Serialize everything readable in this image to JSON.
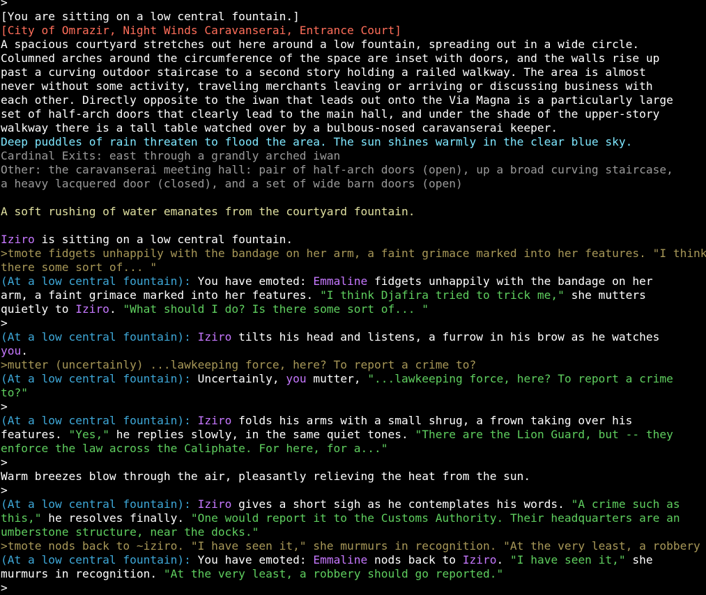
{
  "window": {
    "title": ""
  },
  "colors": {
    "background": "#000000",
    "white": "#ffffff",
    "room_title": "#ff6e5a",
    "weather": "#7fe7ff",
    "exits": "#9a9a9a",
    "ambient": "#e0e0a0",
    "name": "#c678ff",
    "echo": "#a89858",
    "location": "#3ea8d8",
    "speech": "#5fcf5f"
  },
  "terminal": {
    "lines": [
      [
        {
          "t": ">",
          "c": "white"
        }
      ],
      [
        {
          "t": "[You are sitting on a low central fountain.]",
          "c": "white"
        }
      ],
      [
        {
          "t": "[City of Omrazir, Night Winds Caravanserai, Entrance Court]",
          "c": "room_title"
        }
      ],
      [
        {
          "t": "A spacious courtyard stretches out here around a low fountain, spreading out in a wide circle.",
          "c": "white"
        }
      ],
      [
        {
          "t": "Columned arches around the circumference of the space are inset with doors, and the walls rise up",
          "c": "white"
        }
      ],
      [
        {
          "t": "past a curving outdoor staircase to a second story holding a railed walkway. The area is almost",
          "c": "white"
        }
      ],
      [
        {
          "t": "never without some activity, traveling merchants leaving or arriving or discussing business with",
          "c": "white"
        }
      ],
      [
        {
          "t": "each other. Directly opposite to the iwan that leads out onto the Via Magna is a particularly large",
          "c": "white"
        }
      ],
      [
        {
          "t": "set of half-arch doors that clearly lead to the main hall, and under the shade of the upper-story",
          "c": "white"
        }
      ],
      [
        {
          "t": "walkway there is a tall table watched over by a bulbous-nosed caravanserai keeper.",
          "c": "white"
        }
      ],
      [
        {
          "t": "Deep puddles of rain threaten to flood the area. The sun shines warmly in the clear blue sky.",
          "c": "weather"
        }
      ],
      [
        {
          "t": "Cardinal Exits: east through a grandly arched iwan",
          "c": "exits"
        }
      ],
      [
        {
          "t": "Other: the caravanserai meeting hall: pair of half-arch doors (open), up a broad curving staircase,",
          "c": "exits"
        }
      ],
      [
        {
          "t": "a heavy lacquered door (closed), and a set of wide barn doors (open)",
          "c": "exits"
        }
      ],
      [],
      [
        {
          "t": "A soft rushing of water emanates from the courtyard fountain.",
          "c": "ambient"
        }
      ],
      [],
      [
        {
          "t": "Iziro",
          "c": "name"
        },
        {
          "t": " is sitting on a low central fountain.",
          "c": "white"
        }
      ],
      [
        {
          "t": ">tmote fidgets unhappily with the bandage on her arm, a faint grimace marked into her features. \"I think Dj",
          "c": "echo"
        }
      ],
      [
        {
          "t": "there some sort of... \"",
          "c": "echo"
        }
      ],
      [
        {
          "t": "(At a low central fountain): ",
          "c": "location"
        },
        {
          "t": "You have emoted: ",
          "c": "white"
        },
        {
          "t": "Emmaline",
          "c": "name"
        },
        {
          "t": " fidgets unhappily with the bandage on her",
          "c": "white"
        }
      ],
      [
        {
          "t": "arm, a faint grimace marked into her features. ",
          "c": "white"
        },
        {
          "t": "\"I think Djafira tried to trick me,\"",
          "c": "speech"
        },
        {
          "t": " she mutters",
          "c": "white"
        }
      ],
      [
        {
          "t": "quietly to ",
          "c": "white"
        },
        {
          "t": "Iziro",
          "c": "name"
        },
        {
          "t": ". ",
          "c": "white"
        },
        {
          "t": "\"What should I do? Is there some sort of... \"",
          "c": "speech"
        }
      ],
      [
        {
          "t": ">",
          "c": "white"
        }
      ],
      [
        {
          "t": "(At a low central fountain): ",
          "c": "location"
        },
        {
          "t": "Iziro",
          "c": "name"
        },
        {
          "t": " tilts his head and listens, a furrow in his brow as he watches",
          "c": "white"
        }
      ],
      [
        {
          "t": "you",
          "c": "name"
        },
        {
          "t": ".",
          "c": "white"
        }
      ],
      [
        {
          "t": ">mutter (uncertainly) ...lawkeeping force, here? To report a crime to?",
          "c": "echo"
        }
      ],
      [
        {
          "t": "(At a low central fountain): ",
          "c": "location"
        },
        {
          "t": "Uncertainly, ",
          "c": "white"
        },
        {
          "t": "you",
          "c": "name"
        },
        {
          "t": " mutter, ",
          "c": "white"
        },
        {
          "t": "\"...lawkeeping force, here? To report a crime",
          "c": "speech"
        }
      ],
      [
        {
          "t": "to?\"",
          "c": "speech"
        }
      ],
      [
        {
          "t": ">",
          "c": "white"
        }
      ],
      [
        {
          "t": "(At a low central fountain): ",
          "c": "location"
        },
        {
          "t": "Iziro",
          "c": "name"
        },
        {
          "t": " folds his arms with a small shrug, a frown taking over his",
          "c": "white"
        }
      ],
      [
        {
          "t": "features. ",
          "c": "white"
        },
        {
          "t": "\"Yes,\"",
          "c": "speech"
        },
        {
          "t": " he replies slowly, in the same quiet tones. ",
          "c": "white"
        },
        {
          "t": "\"There are the Lion Guard, but -- they",
          "c": "speech"
        }
      ],
      [
        {
          "t": "enforce the law across the Caliphate. For here, for a...\"",
          "c": "speech"
        }
      ],
      [
        {
          "t": ">",
          "c": "white"
        }
      ],
      [
        {
          "t": "Warm breezes blow through the air, pleasantly relieving the heat from the sun.",
          "c": "white"
        }
      ],
      [
        {
          "t": ">",
          "c": "white"
        }
      ],
      [
        {
          "t": "(At a low central fountain): ",
          "c": "location"
        },
        {
          "t": "Iziro",
          "c": "name"
        },
        {
          "t": " gives a short sigh as he contemplates his words. ",
          "c": "white"
        },
        {
          "t": "\"A crime such as",
          "c": "speech"
        }
      ],
      [
        {
          "t": "this,\"",
          "c": "speech"
        },
        {
          "t": " he resolves finally. ",
          "c": "white"
        },
        {
          "t": "\"One would report it to the Customs Authority. Their headquarters are an",
          "c": "speech"
        }
      ],
      [
        {
          "t": "umberstone structure, near the docks.\"",
          "c": "speech"
        }
      ],
      [
        {
          "t": ">tmote nods back to ~iziro. \"I have seen it,\" she murmurs in recognition. \"At the very least, a robbery sh",
          "c": "echo"
        }
      ],
      [
        {
          "t": "(At a low central fountain): ",
          "c": "location"
        },
        {
          "t": "You have emoted: ",
          "c": "white"
        },
        {
          "t": "Emmaline",
          "c": "name"
        },
        {
          "t": " nods back to ",
          "c": "white"
        },
        {
          "t": "Iziro",
          "c": "name"
        },
        {
          "t": ". ",
          "c": "white"
        },
        {
          "t": "\"I have seen it,\"",
          "c": "speech"
        },
        {
          "t": " she",
          "c": "white"
        }
      ],
      [
        {
          "t": "murmurs in recognition. ",
          "c": "white"
        },
        {
          "t": "\"At the very least, a robbery should go reported.\"",
          "c": "speech"
        }
      ],
      [
        {
          "t": ">",
          "c": "white"
        }
      ]
    ]
  }
}
